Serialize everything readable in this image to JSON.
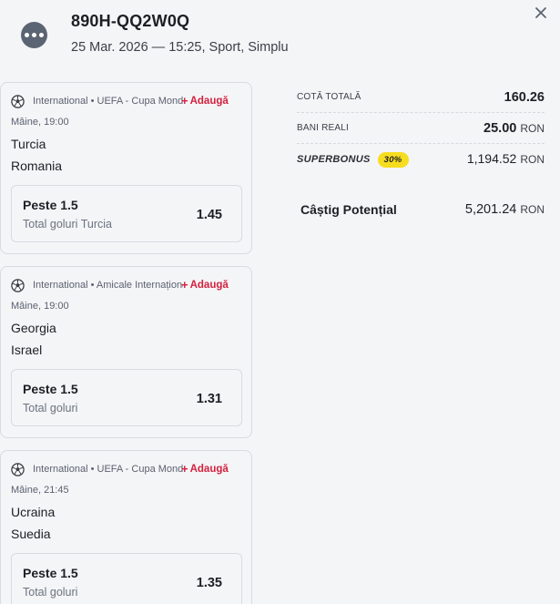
{
  "header": {
    "ticket_id": "890H-QQ2W0Q",
    "subtitle": "25 Mar. 2026 — 15:25, Sport, Simplu",
    "menu_icon": "more-dots-icon",
    "close_icon": "close-icon"
  },
  "add_label": "Adaugă",
  "bets": [
    {
      "league": "International • UEFA - Cupa Mondială - Calificări",
      "kickoff": "Mâine, 19:00",
      "home": "Turcia",
      "away": "Romania",
      "selection": "Peste 1.5",
      "market": "Total goluri Turcia",
      "odd": "1.45"
    },
    {
      "league": "International • Amicale Internaționale",
      "kickoff": "Mâine, 19:00",
      "home": "Georgia",
      "away": "Israel",
      "selection": "Peste 1.5",
      "market": "Total goluri",
      "odd": "1.31"
    },
    {
      "league": "International • UEFA - Cupa Mondială - Calificări",
      "kickoff": "Mâine, 21:45",
      "home": "Ucraina",
      "away": "Suedia",
      "selection": "Peste 1.5",
      "market": "Total goluri",
      "odd": "1.35"
    }
  ],
  "summary": {
    "total_odds_label": "COTĂ TOTALĂ",
    "total_odds": "160.26",
    "stake_label": "BANI REALI",
    "stake": "25.00",
    "currency": "RON",
    "superbonus_label": "SUPERBONUS",
    "superbonus_pct": "30%",
    "superbonus_value": "1,194.52",
    "potential_win_label": "Câștig Potențial",
    "potential_win": "5,201.24"
  },
  "colors": {
    "accent_red": "#d4213d",
    "superbonus_yellow": "#f7dd1f",
    "menu_button": "#5b6472"
  }
}
